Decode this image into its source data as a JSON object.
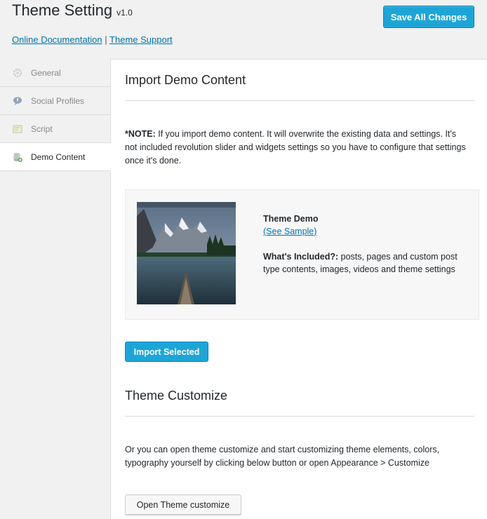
{
  "header": {
    "title": "Theme Setting",
    "version": "v1.0",
    "doc_link": "Online Documentation",
    "separator": "|",
    "support_link": "Theme Support",
    "save_button": "Save All Changes"
  },
  "sidebar": {
    "items": [
      {
        "label": "General",
        "icon": "gear-icon"
      },
      {
        "label": "Social Profiles",
        "icon": "chat-bubble-icon"
      },
      {
        "label": "Script",
        "icon": "script-icon"
      },
      {
        "label": "Demo Content",
        "icon": "database-add-icon",
        "active": true
      }
    ]
  },
  "import_section": {
    "title": "Import Demo Content",
    "note_label": "*NOTE:",
    "note_text": " If you import demo content. It will overwrite the existing data and settings. It's not included revolution slider and widgets settings so you have to configure that settings once it's done.",
    "demo": {
      "name": "Theme Demo",
      "sample_link": "(See Sample)",
      "included_label": "What's Included?:",
      "included_text": " posts, pages and custom post type contents, images, videos and theme settings"
    },
    "import_button": "Import Selected"
  },
  "customize_section": {
    "title": "Theme Customize",
    "text": "Or you can open theme customize and start customizing theme elements, colors, typography yourself by clicking below button or open Appearance > Customize",
    "button": "Open Theme customize"
  },
  "colors": {
    "accent": "#1ea5d8",
    "link": "#0073aa",
    "background": "#f1f1f1"
  }
}
